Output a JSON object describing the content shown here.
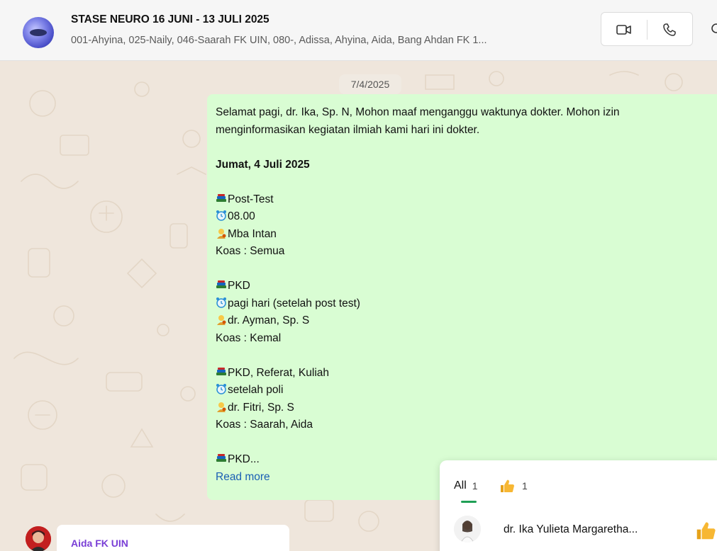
{
  "header": {
    "group_name": "STASE NEURO 16 JUNI - 13 JULI 2025",
    "members": "001-Ahyina, 025-Naily, 046-Saarah FK UIN, 080-, Adissa, Ahyina, Aida, Bang Ahdan FK 1...",
    "video_icon": "video-call-icon",
    "phone_icon": "phone-call-icon",
    "search_icon": "search-icon"
  },
  "chat": {
    "date_separator": "7/4/2025",
    "message": {
      "line1": "Selamat pagi, dr. Ika, Sp. N, Mohon maaf menganggu waktunya dokter. Mohon izin",
      "line2": "menginformasikan kegiatan ilmiah kami hari ini dokter.",
      "date_heading": "Jumat, 4 Juli 2025",
      "items": [
        {
          "activity": "Post-Test",
          "time": "08.00",
          "person": "Mba Intan",
          "koas": "Koas : Semua"
        },
        {
          "activity": "PKD",
          "time": "pagi hari  (setelah post test)",
          "person": "dr. Ayman, Sp. S",
          "koas": "Koas : Kemal"
        },
        {
          "activity": "PKD, Referat, Kuliah",
          "time": "setelah poli",
          "person": "dr. Fitri, Sp. S",
          "koas": "Koas : Saarah, Aida"
        }
      ],
      "truncated": "PKD...",
      "read_more": "Read more"
    },
    "next_message": {
      "sender": "Aida FK UIN"
    }
  },
  "reactions": {
    "all_label": "All",
    "all_count": "1",
    "thumb_count": "1",
    "reactor_name": "dr. Ika Yulieta Margaretha...",
    "reaction_icon": "thumbs-up-icon"
  },
  "colors": {
    "bubble": "#d9fdd3",
    "chat_bg": "#efe6dc",
    "link": "#1a5fb4",
    "tab_underline": "#1f9f55",
    "sender_name": "#7a3fd6"
  }
}
